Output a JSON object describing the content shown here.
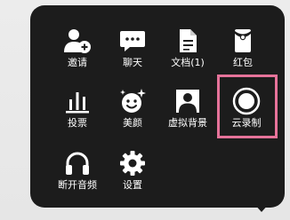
{
  "menu": {
    "items": [
      {
        "id": "invite",
        "label": "邀请",
        "icon": "add-person-icon"
      },
      {
        "id": "chat",
        "label": "聊天",
        "icon": "chat-bubble-icon"
      },
      {
        "id": "docs",
        "label": "文档(1)",
        "icon": "document-icon"
      },
      {
        "id": "red-packet",
        "label": "红包",
        "icon": "red-packet-icon"
      },
      {
        "id": "vote",
        "label": "投票",
        "icon": "bar-chart-icon"
      },
      {
        "id": "beauty",
        "label": "美颜",
        "icon": "sparkle-face-icon"
      },
      {
        "id": "virtual-bg",
        "label": "虚拟背景",
        "icon": "person-background-icon"
      },
      {
        "id": "cloud-record",
        "label": "云录制",
        "icon": "record-circle-icon"
      },
      {
        "id": "disconnect-audio",
        "label": "断开音频",
        "icon": "headphones-icon"
      },
      {
        "id": "settings",
        "label": "设置",
        "icon": "gear-icon"
      }
    ]
  },
  "colors": {
    "panel_background": "#1c1c1c",
    "icon_color": "#ffffff",
    "label_color": "#ffffff",
    "highlight_border": "#e6739a"
  }
}
